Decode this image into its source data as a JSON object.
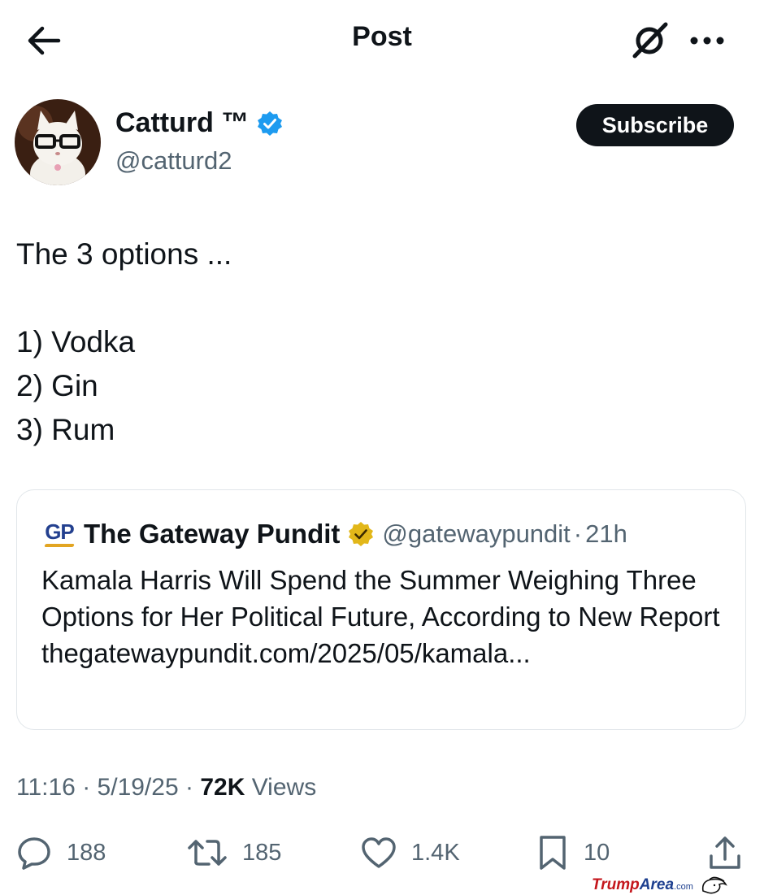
{
  "header": {
    "title": "Post",
    "back_icon": "arrow-left-icon",
    "grok_icon": "grok-icon",
    "more_icon": "more-horizontal-icon"
  },
  "author": {
    "display_name": "Catturd ™",
    "handle": "@catturd2",
    "verified": true,
    "verified_color": "#1d9bf0",
    "avatar_icon": "cat-with-glasses-avatar"
  },
  "subscribe_label": "Subscribe",
  "post": {
    "lines": [
      "The 3 options ...",
      "",
      "1) Vodka",
      "2) Gin",
      "3) Rum"
    ]
  },
  "quote": {
    "logo_text": "GP",
    "name": "The Gateway Pundit",
    "verified_color": "#e2b719",
    "handle": "@gatewaypundit",
    "separator": "·",
    "time": "21h",
    "text": "Kamala Harris Will Spend the Summer Weighing Three Options for Her Political Future, According to New Report thegatewaypundit.com/2025/05/kamala..."
  },
  "meta": {
    "time": "11:16",
    "sep1": "·",
    "date": "5/19/25",
    "sep2": "·",
    "views_count": "72K",
    "views_label": "Views"
  },
  "actions": {
    "reply_count": "188",
    "repost_count": "185",
    "like_count": "1.4K",
    "bookmark_count": "10",
    "icon_color": "#536471"
  },
  "watermark": {
    "text_red": "Trump",
    "text_blue": "Area",
    "suffix": ".com"
  }
}
